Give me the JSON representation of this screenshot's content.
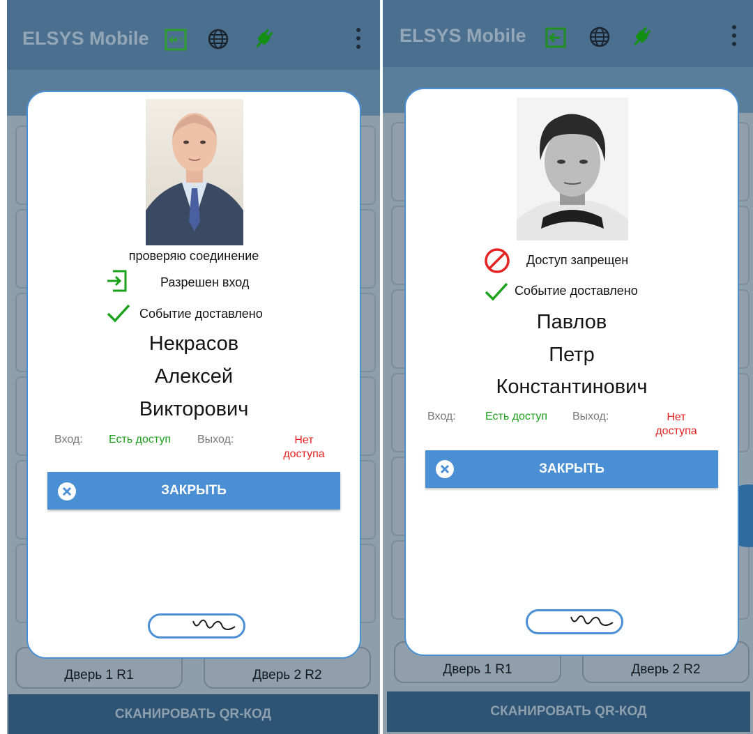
{
  "colors": {
    "appbar": "#4b6f8f",
    "accent": "#4a8fd3",
    "green": "#1a9f1a",
    "red": "#e52222"
  },
  "screens": [
    {
      "app_title": "ELSYS Mobile",
      "header_icons": [
        "direction-unknown-icon",
        "globe-icon",
        "plug-icon",
        "more-vert-icon"
      ],
      "photo": "employee-photo",
      "connection_status": "проверяю соединение",
      "access_icon": "entry-icon",
      "access_result": "Разрешен вход",
      "delivery_icon": "checkmark-icon",
      "delivery_status": "Событие доставлено",
      "last_name": "Некрасов",
      "first_name": "Алексей",
      "patronymic": "Викторович",
      "entry_label": "Вход:",
      "entry_value": "Есть доступ",
      "exit_label": "Выход:",
      "exit_value": "Нет доступа",
      "close_label": "ЗАКРЫТЬ",
      "door1": "Дверь 1 R1",
      "door2": "Дверь 2 R2",
      "scan_label": "СКАНИРОВАТЬ QR-КОД"
    },
    {
      "app_title": "ELSYS Mobile",
      "header_icons": [
        "entry-icon",
        "globe-icon",
        "plug-icon",
        "more-vert-icon"
      ],
      "photo": "employee-photo",
      "access_icon": "prohibited-icon",
      "access_result": "Доступ запрещен",
      "delivery_icon": "checkmark-icon",
      "delivery_status": "Событие доставлено",
      "last_name": "Павлов",
      "first_name": "Петр",
      "patronymic": "Константинович",
      "entry_label": "Вход:",
      "entry_value": "Есть доступ",
      "exit_label": "Выход:",
      "exit_value": "Нет доступа",
      "close_label": "ЗАКРЫТЬ",
      "door1": "Дверь 1 R1",
      "door2": "Дверь 2 R2",
      "scan_label": "СКАНИРОВАТЬ QR-КОД"
    }
  ]
}
